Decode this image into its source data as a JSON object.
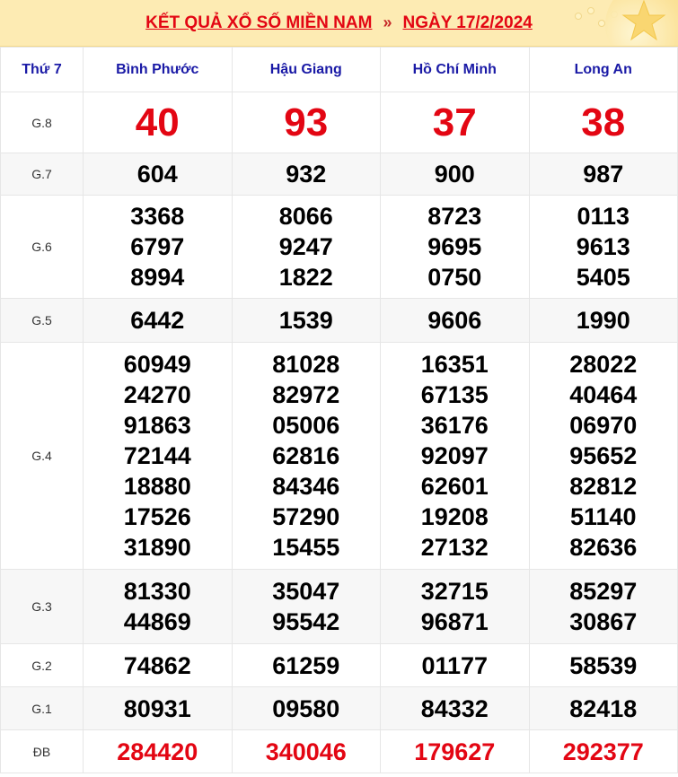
{
  "header": {
    "title": "KẾT QUẢ XỔ SỐ MIỀN NAM",
    "separator": "»",
    "date_label": "NGÀY 17/2/2024"
  },
  "table": {
    "day": "Thứ 7",
    "provinces": [
      "Bình Phước",
      "Hậu Giang",
      "Hồ Chí Minh",
      "Long An"
    ],
    "prizes": [
      {
        "label": "G.8",
        "style": "red-big",
        "values": [
          [
            "40"
          ],
          [
            "93"
          ],
          [
            "37"
          ],
          [
            "38"
          ]
        ]
      },
      {
        "label": "G.7",
        "style": "normal",
        "values": [
          [
            "604"
          ],
          [
            "932"
          ],
          [
            "900"
          ],
          [
            "987"
          ]
        ]
      },
      {
        "label": "G.6",
        "style": "normal",
        "values": [
          [
            "3368",
            "6797",
            "8994"
          ],
          [
            "8066",
            "9247",
            "1822"
          ],
          [
            "8723",
            "9695",
            "0750"
          ],
          [
            "0113",
            "9613",
            "5405"
          ]
        ]
      },
      {
        "label": "G.5",
        "style": "normal",
        "values": [
          [
            "6442"
          ],
          [
            "1539"
          ],
          [
            "9606"
          ],
          [
            "1990"
          ]
        ]
      },
      {
        "label": "G.4",
        "style": "normal",
        "values": [
          [
            "60949",
            "24270",
            "91863",
            "72144",
            "18880",
            "17526",
            "31890"
          ],
          [
            "81028",
            "82972",
            "05006",
            "62816",
            "84346",
            "57290",
            "15455"
          ],
          [
            "16351",
            "67135",
            "36176",
            "92097",
            "62601",
            "19208",
            "27132"
          ],
          [
            "28022",
            "40464",
            "06970",
            "95652",
            "82812",
            "51140",
            "82636"
          ]
        ]
      },
      {
        "label": "G.3",
        "style": "normal",
        "values": [
          [
            "81330",
            "44869"
          ],
          [
            "35047",
            "95542"
          ],
          [
            "32715",
            "96871"
          ],
          [
            "85297",
            "30867"
          ]
        ]
      },
      {
        "label": "G.2",
        "style": "normal",
        "values": [
          [
            "74862"
          ],
          [
            "61259"
          ],
          [
            "01177"
          ],
          [
            "58539"
          ]
        ]
      },
      {
        "label": "G.1",
        "style": "normal",
        "values": [
          [
            "80931"
          ],
          [
            "09580"
          ],
          [
            "84332"
          ],
          [
            "82418"
          ]
        ]
      },
      {
        "label": "ĐB",
        "style": "red-db",
        "values": [
          [
            "284420"
          ],
          [
            "340046"
          ],
          [
            "179627"
          ],
          [
            "292377"
          ]
        ]
      }
    ]
  },
  "colors": {
    "header_bg": "#fdebb3",
    "accent_red": "#e30613",
    "province_blue": "#1a1aa6"
  },
  "icons": [
    "star-icon"
  ]
}
